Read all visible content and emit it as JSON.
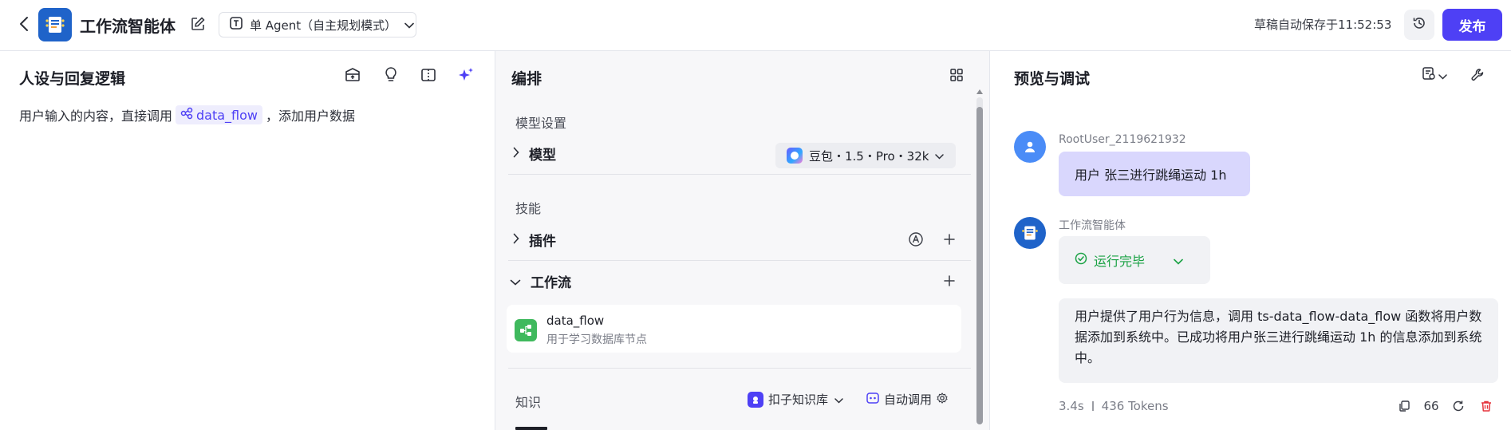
{
  "header": {
    "app_title": "工作流智能体",
    "mode_label": "单 Agent（自主规划模式）",
    "save_status": "草稿自动保存于11:52:53",
    "publish_label": "发布"
  },
  "left_panel": {
    "title": "人设与回复逻辑",
    "prompt_before": "用户输入的内容，直接调用",
    "workflow_chip": "data_flow",
    "prompt_after": "，添加用户数据"
  },
  "middle_panel": {
    "title": "编排",
    "model_section_label": "模型设置",
    "model_row_title": "模型",
    "model_value": "豆包・1.5・Pro・32k",
    "skills_section_label": "技能",
    "plugins_row_title": "插件",
    "workflow_row_title": "工作流",
    "workflow_item": {
      "name": "data_flow",
      "description": "用于学习数据库节点"
    },
    "knowledge_section_label": "知识",
    "knowledge_source": "扣子知识库",
    "auto_call_label": "自动调用"
  },
  "right_panel": {
    "title": "预览与调试",
    "user_name": "RootUser_2119621932",
    "user_message": "用户 张三进行跳绳运动 1h",
    "bot_name": "工作流智能体",
    "run_status": "运行完毕",
    "bot_reply": "用户提供了用户行为信息，调用 ts-data_flow-data_flow 函数将用户数据添加到系统中。已成功将用户张三进行跳绳运动 1h 的信息添加到系统中。",
    "latency": "3.4s",
    "tokens": "436 Tokens",
    "quote_glyph": "66"
  },
  "colors": {
    "primary": "#4e40f5",
    "success": "#1aa244",
    "user_bubble": "#d9d7fd",
    "bot_bubble": "#f1f2f5",
    "delete": "#e5343c"
  },
  "icons": {
    "header": [
      "back-icon",
      "app-logo-icon",
      "edit-icon",
      "agent-mode-icon",
      "chevron-down-icon",
      "history-icon"
    ],
    "left_panel": [
      "prompt-library-icon",
      "lightbulb-icon",
      "split-view-icon",
      "ai-optimize-icon"
    ],
    "middle_panel": [
      "grid-icon",
      "chevron-right-icon",
      "auto-mode-icon",
      "plus-icon",
      "workflow-icon",
      "knowledge-base-icon",
      "settings-icon"
    ],
    "right_panel": [
      "debug-settings-icon",
      "wrench-icon",
      "user-avatar-icon",
      "check-circle-icon",
      "copy-icon",
      "quote-icon",
      "refresh-icon",
      "delete-icon"
    ]
  }
}
